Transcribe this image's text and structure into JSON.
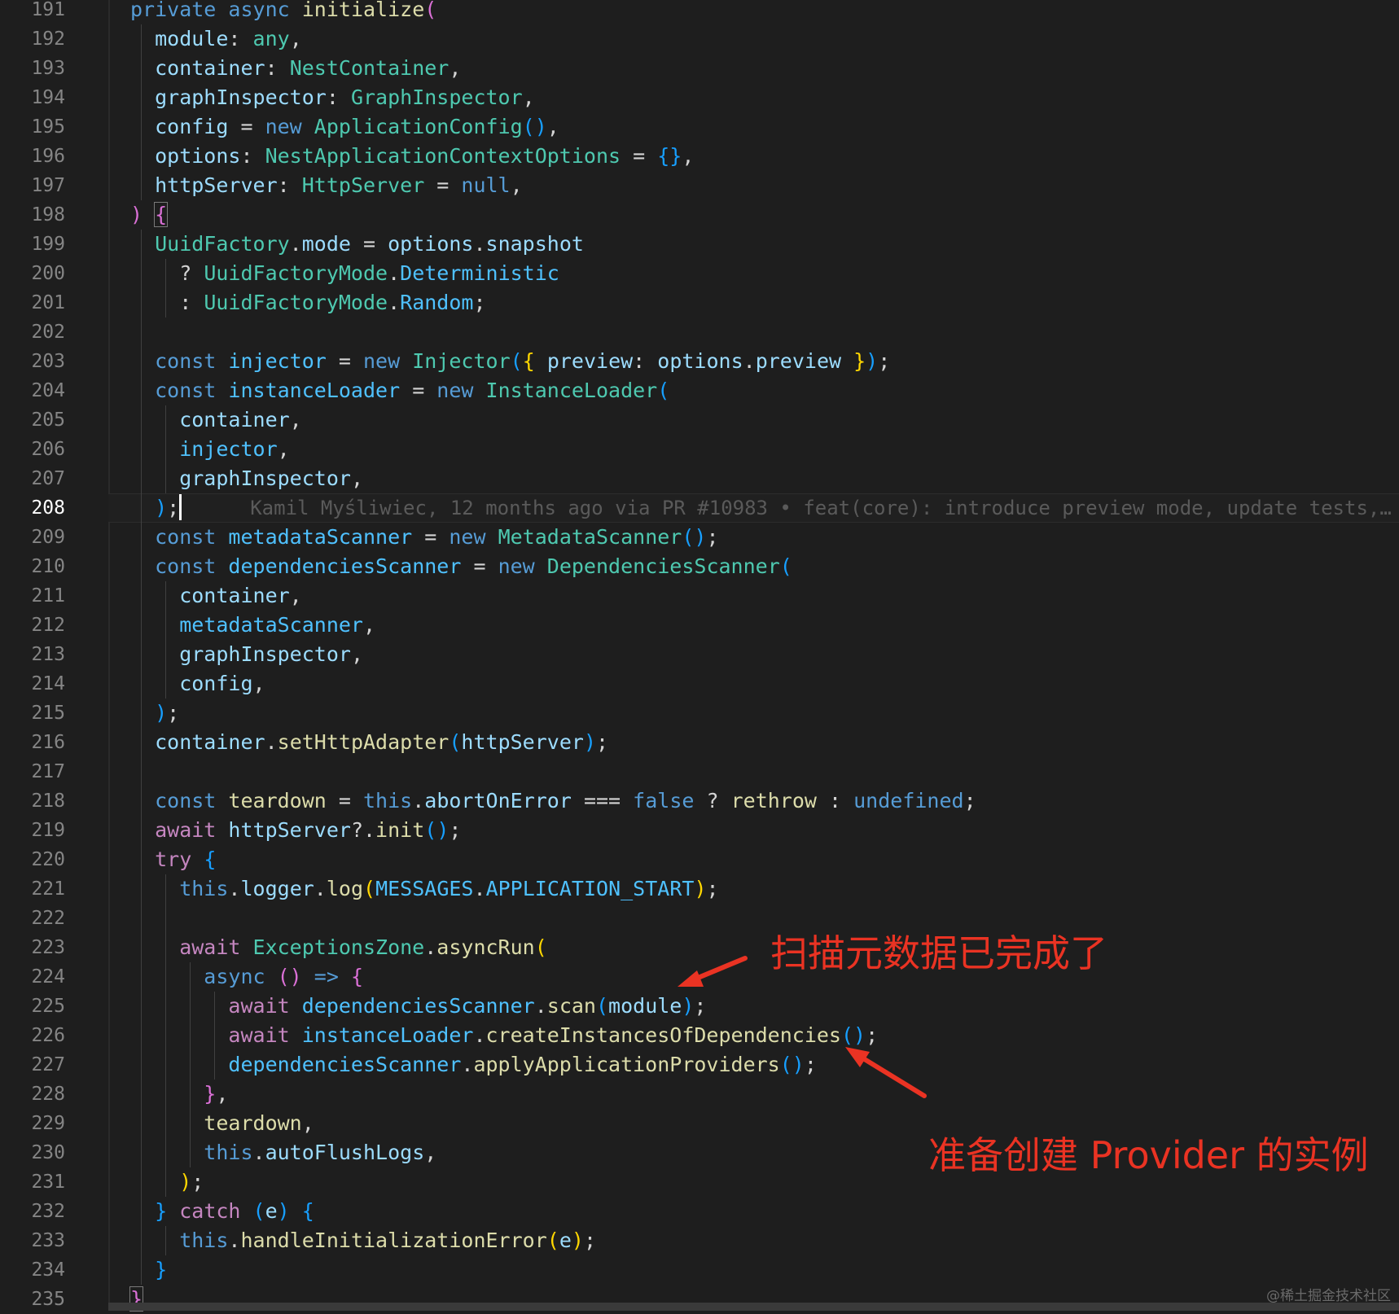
{
  "editor": {
    "lines": [
      {
        "n": "191",
        "tokens": [
          [
            "k",
            "private "
          ],
          [
            "k",
            "async "
          ],
          [
            "f",
            "initialize"
          ],
          [
            "b2",
            "("
          ]
        ]
      },
      {
        "n": "192",
        "tokens": [
          [
            "v",
            "  module"
          ],
          [
            "pl",
            ": "
          ],
          [
            "t",
            "any"
          ],
          [
            "pl",
            ","
          ]
        ]
      },
      {
        "n": "193",
        "tokens": [
          [
            "v",
            "  container"
          ],
          [
            "pl",
            ": "
          ],
          [
            "t",
            "NestContainer"
          ],
          [
            "pl",
            ","
          ]
        ]
      },
      {
        "n": "194",
        "tokens": [
          [
            "v",
            "  graphInspector"
          ],
          [
            "pl",
            ": "
          ],
          [
            "t",
            "GraphInspector"
          ],
          [
            "pl",
            ","
          ]
        ]
      },
      {
        "n": "195",
        "tokens": [
          [
            "v",
            "  config"
          ],
          [
            "pl",
            " = "
          ],
          [
            "k",
            "new "
          ],
          [
            "t",
            "ApplicationConfig"
          ],
          [
            "b3",
            "()"
          ],
          [
            "pl",
            ","
          ]
        ]
      },
      {
        "n": "196",
        "tokens": [
          [
            "v",
            "  options"
          ],
          [
            "pl",
            ": "
          ],
          [
            "t",
            "NestApplicationContextOptions"
          ],
          [
            "pl",
            " = "
          ],
          [
            "b3",
            "{}"
          ],
          [
            "pl",
            ","
          ]
        ]
      },
      {
        "n": "197",
        "tokens": [
          [
            "v",
            "  httpServer"
          ],
          [
            "pl",
            ": "
          ],
          [
            "t",
            "HttpServer"
          ],
          [
            "pl",
            " = "
          ],
          [
            "k",
            "null"
          ],
          [
            "pl",
            ","
          ]
        ]
      },
      {
        "n": "198",
        "tokens": [
          [
            "b2",
            ") "
          ],
          [
            "b2box",
            "{"
          ]
        ]
      },
      {
        "n": "199",
        "tokens": [
          [
            "t",
            "  UuidFactory"
          ],
          [
            "pl",
            "."
          ],
          [
            "v",
            "mode"
          ],
          [
            "pl",
            " = "
          ],
          [
            "v",
            "options"
          ],
          [
            "pl",
            "."
          ],
          [
            "v",
            "snapshot"
          ]
        ]
      },
      {
        "n": "200",
        "tokens": [
          [
            "pl",
            "    ? "
          ],
          [
            "t",
            "UuidFactoryMode"
          ],
          [
            "pl",
            "."
          ],
          [
            "c",
            "Deterministic"
          ]
        ]
      },
      {
        "n": "201",
        "tokens": [
          [
            "pl",
            "    : "
          ],
          [
            "t",
            "UuidFactoryMode"
          ],
          [
            "pl",
            "."
          ],
          [
            "c",
            "Random"
          ],
          [
            "pl",
            ";"
          ]
        ]
      },
      {
        "n": "202",
        "tokens": []
      },
      {
        "n": "203",
        "tokens": [
          [
            "k",
            "  const "
          ],
          [
            "c",
            "injector"
          ],
          [
            "pl",
            " = "
          ],
          [
            "k",
            "new "
          ],
          [
            "t",
            "Injector"
          ],
          [
            "b3",
            "("
          ],
          [
            "b1",
            "{ "
          ],
          [
            "v",
            "preview"
          ],
          [
            "pl",
            ": "
          ],
          [
            "v",
            "options"
          ],
          [
            "pl",
            "."
          ],
          [
            "v",
            "preview"
          ],
          [
            "b1",
            " }"
          ],
          [
            "b3",
            ")"
          ],
          [
            "pl",
            ";"
          ]
        ]
      },
      {
        "n": "204",
        "tokens": [
          [
            "k",
            "  const "
          ],
          [
            "c",
            "instanceLoader"
          ],
          [
            "pl",
            " = "
          ],
          [
            "k",
            "new "
          ],
          [
            "t",
            "InstanceLoader"
          ],
          [
            "b3",
            "("
          ]
        ]
      },
      {
        "n": "205",
        "tokens": [
          [
            "v",
            "    container"
          ],
          [
            "pl",
            ","
          ]
        ]
      },
      {
        "n": "206",
        "tokens": [
          [
            "c",
            "    injector"
          ],
          [
            "pl",
            ","
          ]
        ]
      },
      {
        "n": "207",
        "tokens": [
          [
            "v",
            "    graphInspector"
          ],
          [
            "pl",
            ","
          ]
        ]
      },
      {
        "n": "208",
        "current": true,
        "tokens": [
          [
            "b3",
            "  )"
          ],
          [
            "pl",
            ";"
          ],
          [
            "cursor",
            ""
          ],
          [
            "blame",
            "Kamil Myśliwiec, 12 months ago via PR #10983 • feat(core): introduce preview mode, update tests,…"
          ]
        ]
      },
      {
        "n": "209",
        "tokens": [
          [
            "k",
            "  const "
          ],
          [
            "c",
            "metadataScanner"
          ],
          [
            "pl",
            " = "
          ],
          [
            "k",
            "new "
          ],
          [
            "t",
            "MetadataScanner"
          ],
          [
            "b3",
            "()"
          ],
          [
            "pl",
            ";"
          ]
        ]
      },
      {
        "n": "210",
        "tokens": [
          [
            "k",
            "  const "
          ],
          [
            "c",
            "dependenciesScanner"
          ],
          [
            "pl",
            " = "
          ],
          [
            "k",
            "new "
          ],
          [
            "t",
            "DependenciesScanner"
          ],
          [
            "b3",
            "("
          ]
        ]
      },
      {
        "n": "211",
        "tokens": [
          [
            "v",
            "    container"
          ],
          [
            "pl",
            ","
          ]
        ]
      },
      {
        "n": "212",
        "tokens": [
          [
            "c",
            "    metadataScanner"
          ],
          [
            "pl",
            ","
          ]
        ]
      },
      {
        "n": "213",
        "tokens": [
          [
            "v",
            "    graphInspector"
          ],
          [
            "pl",
            ","
          ]
        ]
      },
      {
        "n": "214",
        "tokens": [
          [
            "v",
            "    config"
          ],
          [
            "pl",
            ","
          ]
        ]
      },
      {
        "n": "215",
        "tokens": [
          [
            "b3",
            "  )"
          ],
          [
            "pl",
            ";"
          ]
        ]
      },
      {
        "n": "216",
        "tokens": [
          [
            "v",
            "  container"
          ],
          [
            "pl",
            "."
          ],
          [
            "f",
            "setHttpAdapter"
          ],
          [
            "b3",
            "("
          ],
          [
            "v",
            "httpServer"
          ],
          [
            "b3",
            ")"
          ],
          [
            "pl",
            ";"
          ]
        ]
      },
      {
        "n": "217",
        "tokens": []
      },
      {
        "n": "218",
        "tokens": [
          [
            "k",
            "  const "
          ],
          [
            "f",
            "teardown"
          ],
          [
            "pl",
            " = "
          ],
          [
            "k",
            "this"
          ],
          [
            "pl",
            "."
          ],
          [
            "v",
            "abortOnError"
          ],
          [
            "pl",
            " === "
          ],
          [
            "k",
            "false"
          ],
          [
            "pl",
            " ? "
          ],
          [
            "f",
            "rethrow"
          ],
          [
            "pl",
            " : "
          ],
          [
            "k",
            "undefined"
          ],
          [
            "pl",
            ";"
          ]
        ]
      },
      {
        "n": "219",
        "tokens": [
          [
            "ctl",
            "  await "
          ],
          [
            "v",
            "httpServer"
          ],
          [
            "pl",
            "?."
          ],
          [
            "f",
            "init"
          ],
          [
            "b3",
            "()"
          ],
          [
            "pl",
            ";"
          ]
        ]
      },
      {
        "n": "220",
        "tokens": [
          [
            "ctl",
            "  try "
          ],
          [
            "b3",
            "{"
          ]
        ]
      },
      {
        "n": "221",
        "tokens": [
          [
            "k",
            "    this"
          ],
          [
            "pl",
            "."
          ],
          [
            "v",
            "logger"
          ],
          [
            "pl",
            "."
          ],
          [
            "f",
            "log"
          ],
          [
            "b1",
            "("
          ],
          [
            "c",
            "MESSAGES"
          ],
          [
            "pl",
            "."
          ],
          [
            "c",
            "APPLICATION_START"
          ],
          [
            "b1",
            ")"
          ],
          [
            "pl",
            ";"
          ]
        ]
      },
      {
        "n": "222",
        "tokens": []
      },
      {
        "n": "223",
        "tokens": [
          [
            "ctl",
            "    await "
          ],
          [
            "t",
            "ExceptionsZone"
          ],
          [
            "pl",
            "."
          ],
          [
            "f",
            "asyncRun"
          ],
          [
            "b1",
            "("
          ]
        ]
      },
      {
        "n": "224",
        "tokens": [
          [
            "k",
            "      async "
          ],
          [
            "b2",
            "() "
          ],
          [
            "k",
            "=> "
          ],
          [
            "b2",
            "{"
          ]
        ]
      },
      {
        "n": "225",
        "tokens": [
          [
            "ctl",
            "        await "
          ],
          [
            "c",
            "dependenciesScanner"
          ],
          [
            "pl",
            "."
          ],
          [
            "f",
            "scan"
          ],
          [
            "b3",
            "("
          ],
          [
            "v",
            "module"
          ],
          [
            "b3",
            ")"
          ],
          [
            "pl",
            ";"
          ]
        ]
      },
      {
        "n": "226",
        "tokens": [
          [
            "ctl",
            "        await "
          ],
          [
            "c",
            "instanceLoader"
          ],
          [
            "pl",
            "."
          ],
          [
            "f",
            "createInstancesOfDependencies"
          ],
          [
            "b3",
            "()"
          ],
          [
            "pl",
            ";"
          ]
        ]
      },
      {
        "n": "227",
        "tokens": [
          [
            "c",
            "        dependenciesScanner"
          ],
          [
            "pl",
            "."
          ],
          [
            "f",
            "applyApplicationProviders"
          ],
          [
            "b3",
            "()"
          ],
          [
            "pl",
            ";"
          ]
        ]
      },
      {
        "n": "228",
        "tokens": [
          [
            "b2",
            "      }"
          ],
          [
            "pl",
            ","
          ]
        ]
      },
      {
        "n": "229",
        "tokens": [
          [
            "f",
            "      teardown"
          ],
          [
            "pl",
            ","
          ]
        ]
      },
      {
        "n": "230",
        "tokens": [
          [
            "k",
            "      this"
          ],
          [
            "pl",
            "."
          ],
          [
            "v",
            "autoFlushLogs"
          ],
          [
            "pl",
            ","
          ]
        ]
      },
      {
        "n": "231",
        "tokens": [
          [
            "b1",
            "    )"
          ],
          [
            "pl",
            ";"
          ]
        ]
      },
      {
        "n": "232",
        "tokens": [
          [
            "b3",
            "  } "
          ],
          [
            "ctl",
            "catch "
          ],
          [
            "b3",
            "("
          ],
          [
            "v",
            "e"
          ],
          [
            "b3",
            ") "
          ],
          [
            "b3",
            "{"
          ]
        ]
      },
      {
        "n": "233",
        "tokens": [
          [
            "k",
            "    this"
          ],
          [
            "pl",
            "."
          ],
          [
            "f",
            "handleInitializationError"
          ],
          [
            "b1",
            "("
          ],
          [
            "v",
            "e"
          ],
          [
            "b1",
            ")"
          ],
          [
            "pl",
            ";"
          ]
        ]
      },
      {
        "n": "234",
        "tokens": [
          [
            "b3",
            "  }"
          ]
        ]
      },
      {
        "n": "235",
        "tokens": [
          [
            "b2box",
            "}"
          ]
        ]
      }
    ]
  },
  "annotations": {
    "scan_done": "扫描元数据已完成了",
    "prepare_create": "准备创建 Provider 的实例"
  },
  "watermark": "@稀土掘金技术社区"
}
